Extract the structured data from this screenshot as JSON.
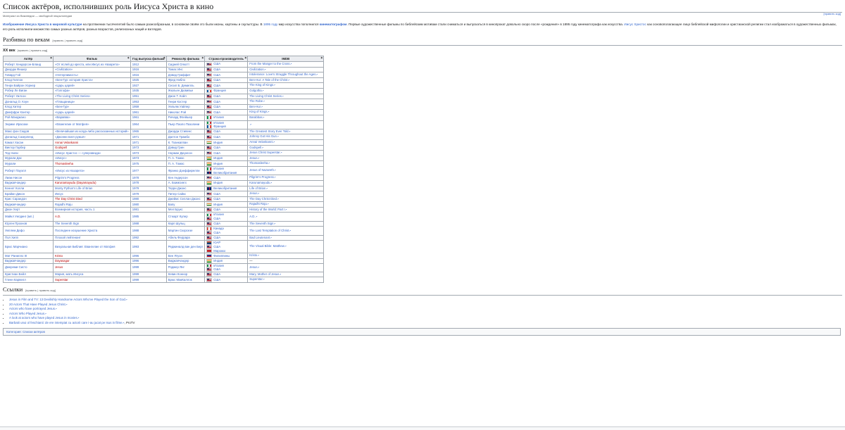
{
  "title": "Список актёров, исполнивших роль Иисуса Христа в кино",
  "tagline": "Материал из Википедии — свободной энциклопедии",
  "edit_label": "[править код]",
  "intro": {
    "link1": "Изображение Иисуса Христа в мировой культуре",
    "t1": " на протяжении тысячелетий было самым разнообразным, в основном своём это были иконы, картины и скульптуры. В ",
    "link2": "1895 году",
    "t2": " мир искусства пополнился ",
    "link3": "кинематографом",
    "t3": ". Первые художественные фильмы по библейским мотивам стали сниматься и выпускаться в кинопрокат довольно скоро после «рождения» в 1895 году кинематографа как искусства. ",
    "link4": "Иисус Христос",
    "t4": " как основополагающее лицо библейской мифологии и христианской религии стал изображаться в художественных фильмах, его роль исполнили множество самых разных актёров, разных возрастов, религиозных наций и взглядов."
  },
  "section1": {
    "title": "Разбивка по векам",
    "edit": "[править | править код]"
  },
  "subsection1": {
    "title": "XX век",
    "edit": "[править | править код]"
  },
  "table": {
    "headers": [
      "Актёр",
      "Фильм",
      "Год выпуска фильма",
      "Режиссёр фильма",
      "Страна-производитель",
      "IMDB"
    ],
    "sort_glyph": "◆",
    "ext_glyph": "↗",
    "rows": [
      {
        "actor": "Роберт Хендерсон-Бланд",
        "film": "«От яслей до креста, или Иисус из Назарета»",
        "year": "1912",
        "director": "Сидней Олкотт",
        "countries": [
          {
            "flag": "us",
            "name": "США"
          }
        ],
        "imdb": "From the Manger to the Cross"
      },
      {
        "actor": "Джордж Фишер",
        "film": "«Civilization»",
        "year": "1916",
        "director": "Томас Инс",
        "countries": [
          {
            "flag": "us",
            "name": "США"
          }
        ],
        "imdb": "Civilization"
      },
      {
        "actor": "Говард Гэй",
        "film": "«Нетерпимость»",
        "year": "1916",
        "director": "Дэвид Гриффит",
        "countries": [
          {
            "flag": "us",
            "name": "США"
          }
        ],
        "imdb": "Intolerance: Love's Struggle Throughout the Ages"
      },
      {
        "actor": "Клод Гиллон",
        "film": "«Бен-Гур: история Христа»",
        "year": "1925",
        "director": "Фред Нибло",
        "countries": [
          {
            "flag": "us",
            "name": "США"
          }
        ],
        "imdb": "Ben-Hur: A Tale of the Christ"
      },
      {
        "actor": "Генри Байрон Уорнер",
        "film": "«Царь царей»",
        "year": "1927",
        "director": "Сесил Б. Демилль",
        "countries": [
          {
            "flag": "us",
            "name": "США"
          }
        ],
        "imdb": "The King of Kings"
      },
      {
        "actor": "Робер Ле Виган",
        "film": "«Голгофа»",
        "year": "1935",
        "director": "Жюльен Дювивье",
        "countries": [
          {
            "flag": "fr",
            "name": "Франция"
          }
        ],
        "imdb": "Golgotha"
      },
      {
        "actor": "Роберт Уилсон",
        "film": "«The Living Christ Series»",
        "year": "1951",
        "director": "Джон Т. Койл",
        "countries": [
          {
            "flag": "us",
            "name": "США"
          }
        ],
        "imdb": "The Living Christ Series"
      },
      {
        "actor": "Дональд О. Кэун",
        "film": "«Плащаница»",
        "year": "1953",
        "director": "Генри Костер",
        "countries": [
          {
            "flag": "us",
            "name": "США"
          }
        ],
        "imdb": "The Robe"
      },
      {
        "actor": "Клод Хитер",
        "film": "«Бен-Гур»",
        "year": "1959",
        "director": "Уильям Уайлер",
        "countries": [
          {
            "flag": "us",
            "name": "США"
          }
        ],
        "imdb": "Ben-Hur"
      },
      {
        "actor": "Джеффри Хантер",
        "film": "«Царь царей»",
        "year": "1961",
        "director": "Николас Рэй",
        "countries": [
          {
            "flag": "us",
            "name": "США"
          }
        ],
        "imdb": "King of Kings"
      },
      {
        "actor": "Рой Манджано",
        "film": "«Варавва»",
        "year": "1961",
        "director": "Ричард Флейшер",
        "countries": [
          {
            "flag": "it",
            "name": "Италия"
          }
        ],
        "imdb": "Barabbas"
      },
      {
        "actor": "Энрике Ирасоки",
        "film": "«Евангелие от Матфея»",
        "year": "1964",
        "director": "Пьер Паоло Пазолини",
        "countries": [
          {
            "flag": "it",
            "name": "Италия"
          },
          {
            "flag": "fr",
            "name": "Франция"
          }
        ],
        "imdb": ""
      },
      {
        "actor": "Макс фон Сюдов",
        "film": "«Величайшая из когда-либо рассказанных историй»",
        "year": "1965",
        "director": "Джордж Стивенс",
        "countries": [
          {
            "flag": "us",
            "name": "США"
          }
        ],
        "imdb": "The Greatest Story Ever Told"
      },
      {
        "actor": "Дональд Сазерленд",
        "film": "«Джонни взял ружьё»",
        "year": "1971",
        "director": "Далтон Трамбо",
        "countries": [
          {
            "flag": "us",
            "name": "США"
          }
        ],
        "imdb": "Johnny Got His Gun"
      },
      {
        "actor": "Камал Хасан",
        "film": "Annai Velankanni",
        "year": "1971",
        "director": "К. Тханкаппан",
        "countries": [
          {
            "flag": "in",
            "name": "Индия"
          }
        ],
        "imdb": "Annai Velankanni"
      },
      {
        "actor": "Виктор Гарбер",
        "film": "Godspell",
        "year": "1973",
        "director": "Дэвид Грин",
        "countries": [
          {
            "flag": "us",
            "name": "США"
          }
        ],
        "imdb": "Godspell"
      },
      {
        "actor": "Тед Нили",
        "film": "«Иисус Христос — суперзвезда»",
        "year": "1973",
        "director": "Норман Джуисон",
        "countries": [
          {
            "flag": "us",
            "name": "США"
          }
        ],
        "imdb": "Jesus Christ Superstar"
      },
      {
        "actor": "Мурали Дас",
        "film": "«Иисус»",
        "year": "1973",
        "director": "П. А. Томас",
        "countries": [
          {
            "flag": "in",
            "name": "Индия"
          }
        ],
        "imdb": "Jesus"
      },
      {
        "actor": "Мурали",
        "film": "Thomasleeha",
        "year": "1975",
        "director": "П. А. Томас",
        "countries": [
          {
            "flag": "in",
            "name": "Индия"
          }
        ],
        "imdb": "Thomasleeha"
      },
      {
        "actor": "Роберт Пауэлл",
        "film": "«Иисус из Назарета»",
        "year": "1977",
        "director": "Франко Дзеффирелли",
        "countries": [
          {
            "flag": "it",
            "name": "Италия"
          },
          {
            "flag": "gb",
            "name": "Великобритания"
          }
        ],
        "imdb": "Jesus of Nazareth"
      },
      {
        "actor": "Лиам Нисон",
        "film": "Pilgrim's Progress",
        "year": "1978",
        "director": "Кен Андерсон",
        "countries": [
          {
            "flag": "us",
            "name": "США"
          }
        ],
        "imdb": "Pilgrim's Progress"
      },
      {
        "actor": "Виджаячандер",
        "film": "Karunamayudu (Dayamayudu)",
        "year": "1978",
        "director": "А. Бхимсингх",
        "countries": [
          {
            "flag": "in",
            "name": "Индия"
          }
        ],
        "imdb": "Karunamayudu"
      },
      {
        "actor": "Кеннет Колли",
        "film": "Monty Python's Life of Brian",
        "year": "1979",
        "director": "Терри Джонс",
        "countries": [
          {
            "flag": "gb",
            "name": "Великобритания"
          }
        ],
        "imdb": "Life of Brian"
      },
      {
        "actor": "Брайан Дикон",
        "film": "Иисус",
        "year": "1979",
        "director": "Питер Сайкс",
        "countries": [
          {
            "flag": "us",
            "name": "США"
          }
        ],
        "imdb": "Jesus"
      },
      {
        "actor": "Крис Сарандон",
        "film": "The Day Christ Died",
        "year": "1980",
        "director": "Джеймс Селлан Джонс",
        "countries": [
          {
            "flag": "us",
            "name": "США"
          }
        ],
        "imdb": "The Day Christ Died"
      },
      {
        "actor": "Виджаячандер",
        "film": "Rajadhi Raju",
        "year": "1980",
        "director": "Бапу",
        "countries": [
          {
            "flag": "in",
            "name": "Индия"
          }
        ],
        "imdb": "Rajadhi Raju"
      },
      {
        "actor": "Джон Херт",
        "film": "Всемирная история, часть 1",
        "year": "1981",
        "director": "Мел Брукс",
        "countries": [
          {
            "flag": "us",
            "name": "США"
          }
        ],
        "imdb": "History of the World: Part I"
      },
      {
        "actor": "Майкл Уилдинг (мл.)",
        "film": "A.D.",
        "year": "1985",
        "director": "Стюарт Купер",
        "countries": [
          {
            "flag": "it",
            "name": "Италия"
          },
          {
            "flag": "us",
            "name": "США"
          }
        ],
        "imdb": "A.D."
      },
      {
        "actor": "Юрген Прохнов",
        "film": "The Seventh Sign",
        "year": "1988",
        "director": "Карл Шульц",
        "countries": [
          {
            "flag": "us",
            "name": "США"
          }
        ],
        "imdb": "The Seventh Sign"
      },
      {
        "actor": "Уиллем Дефо",
        "film": "Последнее искушение Христа",
        "year": "1988",
        "director": "Мартин Скорсезе",
        "countries": [
          {
            "flag": "ca",
            "name": "Канада"
          },
          {
            "flag": "us",
            "name": "США"
          }
        ],
        "imdb": "The Last Temptation of Christ"
      },
      {
        "actor": "Пол Хипп",
        "film": "Плохой лейтенант",
        "year": "1992",
        "director": "Абель Феррара",
        "countries": [
          {
            "flag": "us",
            "name": "США"
          }
        ],
        "imdb": "Bad Lieutenant"
      },
      {
        "actor": "Брюс Марчиано",
        "film": "Визуальная Библия: Евангелие от Матфея",
        "year": "1993",
        "director": "Реджиналд ван ден Берг",
        "countries": [
          {
            "flag": "za",
            "name": "ЮАР"
          },
          {
            "flag": "us",
            "name": "США"
          },
          {
            "flag": "ma",
            "name": "Марокко"
          }
        ],
        "imdb": "The Visual Bible: Matthew"
      },
      {
        "actor": "Мат Ранилло III",
        "film": "Kristo",
        "year": "1996",
        "director": "Бен Ягуэн",
        "countries": [
          {
            "flag": "ph",
            "name": "Филиппины"
          }
        ],
        "imdb": "Kristo"
      },
      {
        "actor": "Виджаячандер",
        "film": "Dayasagar",
        "year": "1996",
        "director": "Виджаячандер",
        "countries": [
          {
            "flag": "in",
            "name": "Индия"
          }
        ],
        "imdb": "—"
      },
      {
        "actor": "Джереми Систо",
        "film": "Jesus",
        "year": "1999",
        "director": "Роджер Янг",
        "countries": [
          {
            "flag": "it",
            "name": "Италия"
          },
          {
            "flag": "us",
            "name": "США"
          }
        ],
        "imdb": "Jesus"
      },
      {
        "actor": "Кристиан Бейл",
        "film": "Мария, мать Иисуса",
        "year": "1999",
        "director": "Кевин Коннор",
        "countries": [
          {
            "flag": "us",
            "name": "США"
          }
        ],
        "imdb": "Mary, Mother of Jesus"
      },
      {
        "actor": "Гленн Карвелл",
        "film": "Superstar",
        "year": "1999",
        "director": "Брюс МакКаллок",
        "countries": [
          {
            "flag": "us",
            "name": "США"
          }
        ],
        "imdb": "Superstar"
      }
    ]
  },
  "section2": {
    "title": "Ссылки",
    "edit": "[править | править код]"
  },
  "refs": [
    "Jesus in Film and TV: 13 Devilishly Handsome Actors Who've Played the Son of God",
    "20 Actors That Have Played Jesus Christ",
    "Actors who have portrayed Jesus",
    "Actors Who Played Jesus",
    "A look at actors who have played Jesus in movies",
    "Barbatii unui ol feschianii: de ere intempiat cu actorii care i-au jucat pe Isus in filme"
  ],
  "refs_suffix": ", ProTV",
  "category": "Категория: Списки актёров"
}
